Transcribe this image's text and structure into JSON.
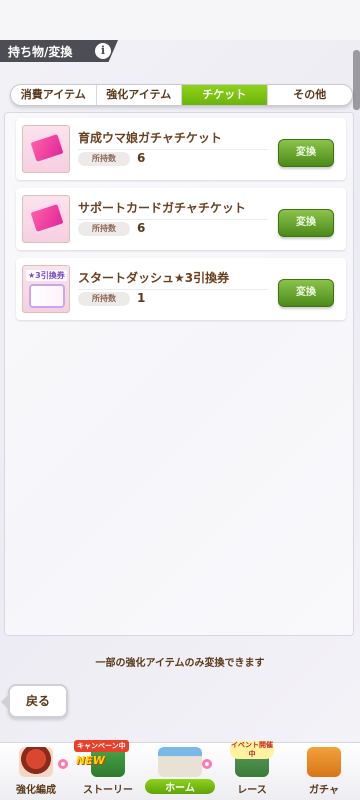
{
  "header": {
    "title": "持ち物/変換",
    "info_icon": "i"
  },
  "tabs": [
    {
      "label": "消費アイテム",
      "active": false
    },
    {
      "label": "強化アイテム",
      "active": false
    },
    {
      "label": "チケット",
      "active": true
    },
    {
      "label": "その他",
      "active": false
    }
  ],
  "items": [
    {
      "name": "育成ウマ娘ガチャチケット",
      "held_label": "所持数",
      "count": "6",
      "button": "変換",
      "icon": "pink-ticket-icon"
    },
    {
      "name": "サポートカードガチャチケット",
      "held_label": "所持数",
      "count": "6",
      "button": "変換",
      "icon": "pink-ticket-icon"
    },
    {
      "name": "スタートダッシュ★3引換券",
      "held_label": "所持数",
      "count": "1",
      "button": "変換",
      "icon": "star3-exchange-ticket-icon",
      "icon_badge": "★3引換券"
    }
  ],
  "notice": "一部の強化アイテムのみ変換できます",
  "back_button": "戻る",
  "bottom_nav": [
    {
      "label": "強化編成",
      "icon": "horse-girl-icon"
    },
    {
      "label": "ストーリー",
      "icon": "story-book-icon",
      "badge_campaign": "キャンペーン中",
      "badge_new": "NEW"
    },
    {
      "label": "ホーム",
      "icon": "home-building-icon",
      "active": true
    },
    {
      "label": "レース",
      "icon": "race-board-icon",
      "badge_event": "イベント開催中"
    },
    {
      "label": "ガチャ",
      "icon": "gacha-icon"
    }
  ],
  "colors": {
    "accent_green": "#7cc313",
    "title_bar": "#4d4d55",
    "text_brown": "#5a3a1a"
  }
}
